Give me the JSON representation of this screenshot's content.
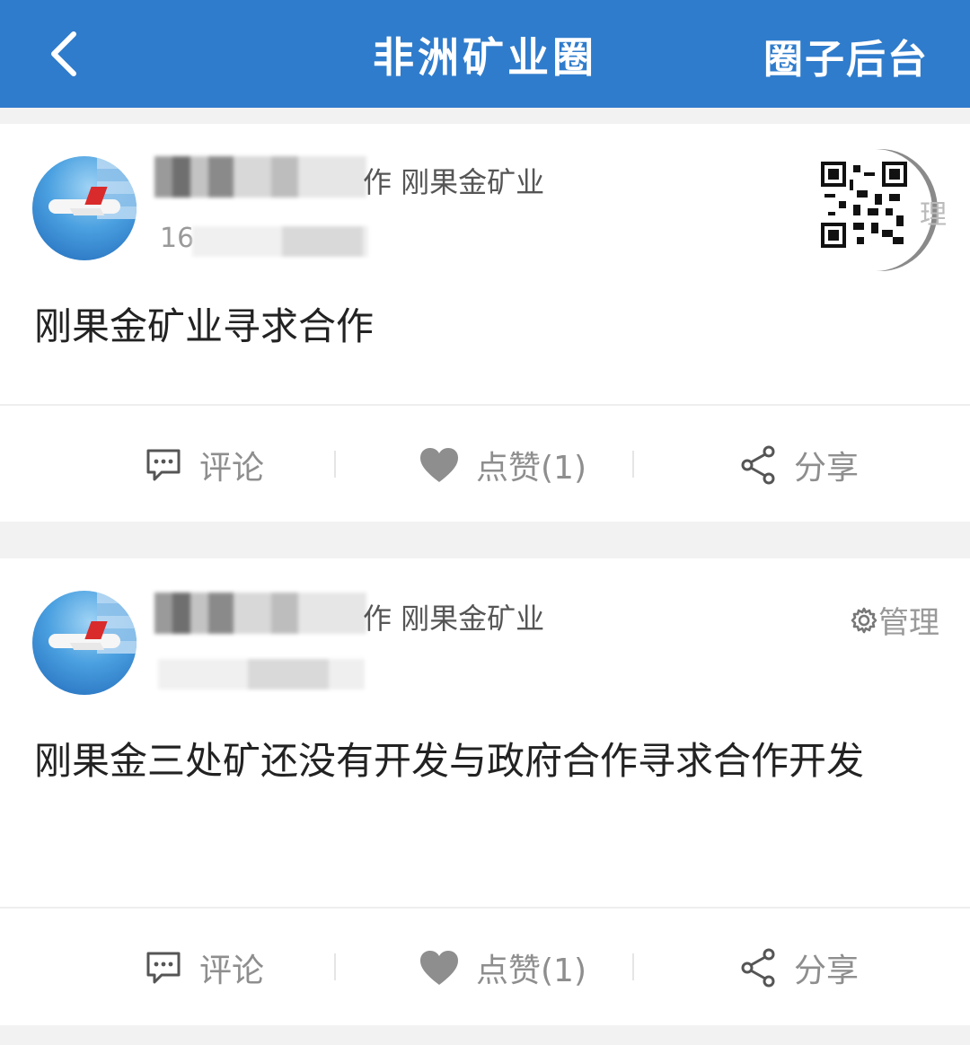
{
  "header": {
    "back_icon": "chevron-left-icon",
    "title": "非洲矿业圈",
    "backend_link": "圈子后台"
  },
  "posts": [
    {
      "author_suffix": "作 刚果金矿业",
      "time_partial": "16",
      "content": "刚果金矿业寻求合作",
      "manage_label": "理",
      "actions": {
        "comment": "评论",
        "like": "点赞(1)",
        "share": "分享"
      }
    },
    {
      "author_suffix": "作 刚果金矿业",
      "content": "刚果金三处矿还没有开发与政府合作寻求合作开发",
      "manage_label": "管理",
      "actions": {
        "comment": "评论",
        "like": "点赞(1)",
        "share": "分享"
      }
    }
  ],
  "colors": {
    "header_bg": "#2f7ccc",
    "action_gray": "#8e8e8e"
  }
}
